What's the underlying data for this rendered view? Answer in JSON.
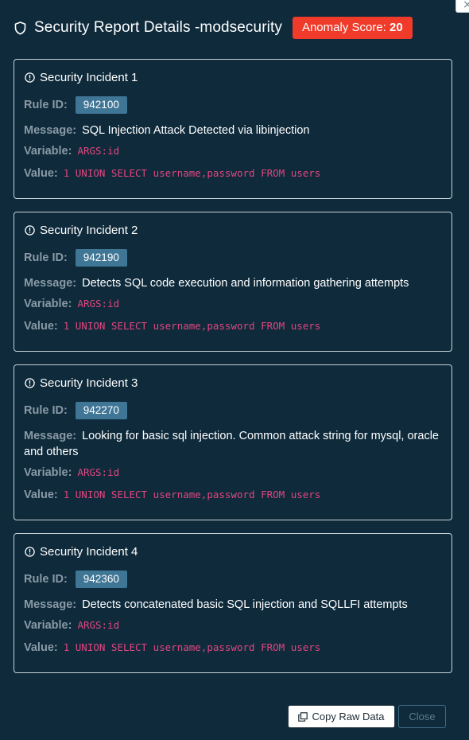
{
  "modal": {
    "title": "Security Report Details -modsecurity",
    "score_label": "Anomaly Score:",
    "score_value": "20",
    "close_glyph": "×"
  },
  "labels": {
    "rule_id": "Rule ID:",
    "message": "Message:",
    "variable": "Variable:",
    "value": "Value:"
  },
  "incidents": [
    {
      "title": "Security Incident 1",
      "rule_id": "942100",
      "message": "SQL Injection Attack Detected via libinjection",
      "variable": "ARGS:id",
      "value": "1 UNION SELECT username,password FROM users"
    },
    {
      "title": "Security Incident 2",
      "rule_id": "942190",
      "message": "Detects SQL code execution and information gathering attempts",
      "variable": "ARGS:id",
      "value": "1 UNION SELECT username,password FROM users"
    },
    {
      "title": "Security Incident 3",
      "rule_id": "942270",
      "message": "Looking for basic sql injection. Common attack string for mysql, oracle and others",
      "variable": "ARGS:id",
      "value": "1 UNION SELECT username,password FROM users"
    },
    {
      "title": "Security Incident 4",
      "rule_id": "942360",
      "message": "Detects concatenated basic SQL injection and SQLLFI attempts",
      "variable": "ARGS:id",
      "value": "1 UNION SELECT username,password FROM users"
    }
  ],
  "footer": {
    "copy_label": "Copy Raw Data",
    "close_label": "Close"
  },
  "colors": {
    "background": "#0e2a3b",
    "score_badge": "#f03b2b",
    "rule_badge": "#3f7595",
    "code_text": "#e2467f"
  },
  "icons": {
    "header": "shield-icon",
    "incident": "alert-circle-icon",
    "copy": "copy-icon",
    "dismiss": "close-icon"
  }
}
